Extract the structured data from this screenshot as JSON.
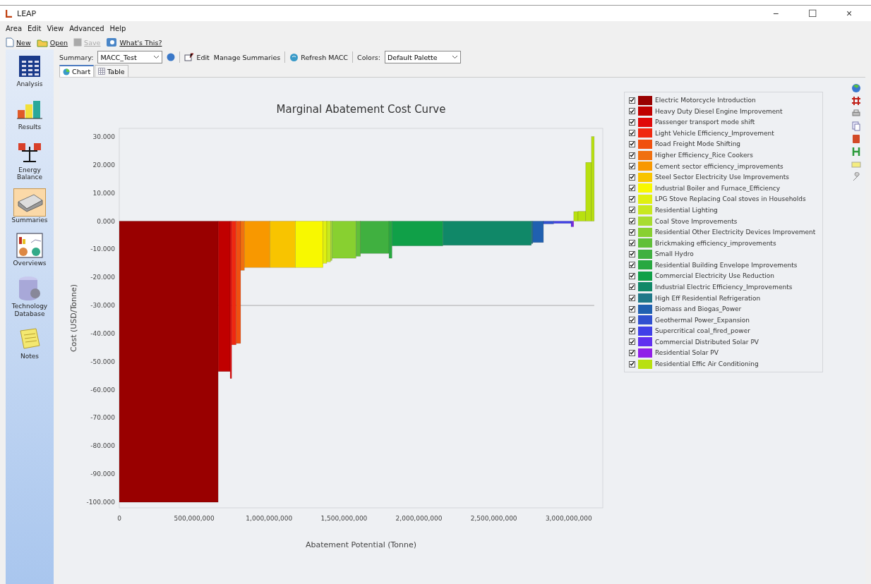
{
  "window": {
    "title": "LEAP",
    "controls": [
      "−",
      "☐",
      "×"
    ]
  },
  "menu": [
    "Area",
    "Edit",
    "View",
    "Advanced",
    "Help"
  ],
  "toolbar": [
    {
      "label": "New",
      "disabled": false
    },
    {
      "label": "Open",
      "disabled": false
    },
    {
      "label": "Save",
      "disabled": true
    },
    {
      "label": "What's This?",
      "disabled": false
    }
  ],
  "sidebar": {
    "items": [
      {
        "label": "Analysis",
        "selected": false
      },
      {
        "label": "Results",
        "selected": false
      },
      {
        "label": "Energy Balance",
        "selected": false
      },
      {
        "label": "Summaries",
        "selected": true
      },
      {
        "label": "Overviews",
        "selected": false
      },
      {
        "label": "Technology Database",
        "selected": false
      },
      {
        "label": "Notes",
        "selected": false
      }
    ]
  },
  "summary_bar": {
    "summary_label": "Summary:",
    "summary_value": "MACC_Test",
    "edit": "Edit",
    "manage": "Manage Summaries",
    "refresh": "Refresh MACC",
    "colors_label": "Colors:",
    "colors_value": "Default Palette"
  },
  "tabs": [
    {
      "label": "Chart",
      "selected": true
    },
    {
      "label": "Table",
      "selected": false
    }
  ],
  "chart": {
    "chart_data": {
      "type": "bar",
      "title": "Marginal Abatement Cost Curve",
      "xlabel": "Abatement Potential (Tonne)",
      "ylabel": "Cost (USD/Tonne)",
      "x": [
        330000000,
        700000000,
        745000000,
        765000000,
        795000000,
        822500000,
        920000000,
        1090000000,
        1267500000,
        1372500000,
        1397500000,
        1415000000,
        1500000000,
        1595000000,
        1705000000,
        1810000000,
        1990000000,
        2455000000,
        2755000000,
        2795500000,
        2865500000,
        2957500000,
        3020000000,
        3029000000,
        3047500000,
        3087500000,
        3132000000,
        3160500000
      ],
      "series": [
        {
          "values": [
            -100,
            -53.5,
            -56,
            -44,
            -43.5,
            -17.5,
            -16.5,
            -16.5,
            -16.5,
            -15,
            -14.5,
            -14,
            -13.2,
            -12.5,
            -11.5,
            -13.2,
            -8.8,
            -8.6,
            -8,
            -7.6,
            -1,
            -0.8,
            -2,
            -2,
            3.4,
            3.5,
            20.9,
            30.1
          ]
        }
      ],
      "xlim": [
        0,
        3227000000
      ],
      "ylim": [
        -102,
        33
      ],
      "xticks": [
        {
          "value": 0,
          "label": "0"
        },
        {
          "value": 500000000,
          "label": "500,000,000"
        },
        {
          "value": 1000000000,
          "label": "1,000,000,000"
        },
        {
          "value": 1500000000,
          "label": "1,500,000,000"
        },
        {
          "value": 2000000000,
          "label": "2,000,000,000"
        },
        {
          "value": 2500000000,
          "label": "2,500,000,000"
        },
        {
          "value": 3000000000,
          "label": "3,000,000,000"
        }
      ],
      "yticks": [
        {
          "value": 30,
          "label": "30.000"
        },
        {
          "value": 20,
          "label": "20.000"
        },
        {
          "value": 10,
          "label": "10.000"
        },
        {
          "value": 0,
          "label": "0.000"
        },
        {
          "value": -10,
          "label": "-10.000"
        },
        {
          "value": -20,
          "label": "-20.000"
        },
        {
          "value": -30,
          "label": "-30.000"
        },
        {
          "value": -40,
          "label": "-40.000"
        },
        {
          "value": -50,
          "label": "-50.000"
        },
        {
          "value": -60,
          "label": "-60.000"
        },
        {
          "value": -70,
          "label": "-70.000"
        },
        {
          "value": -80,
          "label": "-80.000"
        },
        {
          "value": -90,
          "label": "-90.000"
        },
        {
          "value": -100,
          "label": "-100.000"
        }
      ],
      "ref_lines": [
        {
          "axis": "y",
          "value": -30
        }
      ]
    }
  },
  "legend": [
    {
      "label": "Electric Motorcycle Introduction",
      "color": "#990000",
      "checked": true
    },
    {
      "label": "Heavy Duty Diesel Engine Improvement",
      "color": "#c00000",
      "checked": true
    },
    {
      "label": "Passenger transport mode shift",
      "color": "#e00808",
      "checked": true
    },
    {
      "label": "Light Vehicle Efficiency_Improvement",
      "color": "#f02810",
      "checked": true
    },
    {
      "label": "Road Freight Mode Shifting",
      "color": "#f05010",
      "checked": true
    },
    {
      "label": "Higher Efficiency_Rice Cookers",
      "color": "#f07010",
      "checked": true
    },
    {
      "label": "Cement sector efficiency_improvements",
      "color": "#f89800",
      "checked": true
    },
    {
      "label": "Steel Sector Electricity Use Improvements",
      "color": "#f8c400",
      "checked": true
    },
    {
      "label": "Industrial Boiler and Furnace_Efficiency",
      "color": "#f8f800",
      "checked": true
    },
    {
      "label": "LPG Stove Replacing Coal stoves in Households",
      "color": "#e0f010",
      "checked": true
    },
    {
      "label": "Residential Lighting",
      "color": "#c8e820",
      "checked": true
    },
    {
      "label": "Coal Stove Improvements",
      "color": "#a8dc30",
      "checked": true
    },
    {
      "label": "Residential Other Electricity Devices Improvement",
      "color": "#88d030",
      "checked": true
    },
    {
      "label": "Brickmaking efficiency_improvements",
      "color": "#60c038",
      "checked": true
    },
    {
      "label": "Small Hydro",
      "color": "#40b040",
      "checked": true
    },
    {
      "label": "Residential Building Envelope Improvements",
      "color": "#28a840",
      "checked": true
    },
    {
      "label": "Commercial Electricity Use Reduction",
      "color": "#10a048",
      "checked": true
    },
    {
      "label": "Industrial Electric Efficiency_Improvements",
      "color": "#108868",
      "checked": true
    },
    {
      "label": "High Eff Residential Refrigeration",
      "color": "#207888",
      "checked": true
    },
    {
      "label": "Biomass and Biogas_Power",
      "color": "#2060b0",
      "checked": true
    },
    {
      "label": "Geothermal Power_Expansion",
      "color": "#3050d0",
      "checked": true
    },
    {
      "label": "Supercritical coal_fired_power",
      "color": "#4040e8",
      "checked": true
    },
    {
      "label": "Commercial Distributed Solar PV",
      "color": "#6030f0",
      "checked": true
    },
    {
      "label": "Residential Solar PV",
      "color": "#9020e8",
      "checked": true
    },
    {
      "label": "Residential Effic Air Conditioning",
      "color": "#b8e010",
      "checked": true
    }
  ]
}
